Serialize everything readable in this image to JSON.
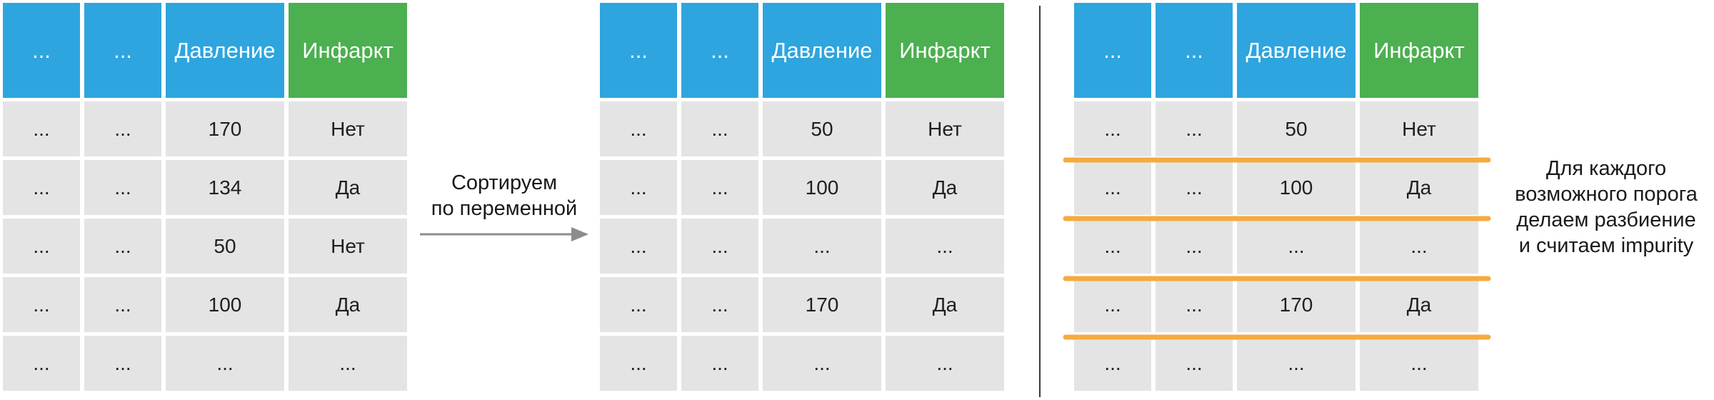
{
  "headers": [
    "...",
    "...",
    "Давление",
    "Инфаркт"
  ],
  "header_colors": [
    "#2ea5de",
    "#2ea5de",
    "#2ea5de",
    "#4caf50"
  ],
  "accent_line_color": "#f5ab3e",
  "tables": [
    {
      "rows": [
        [
          "...",
          "...",
          "170",
          "Нет"
        ],
        [
          "...",
          "...",
          "134",
          "Да"
        ],
        [
          "...",
          "...",
          "50",
          "Нет"
        ],
        [
          "...",
          "...",
          "100",
          "Да"
        ],
        [
          "...",
          "...",
          "...",
          "..."
        ]
      ]
    },
    {
      "rows": [
        [
          "...",
          "...",
          "50",
          "Нет"
        ],
        [
          "...",
          "...",
          "100",
          "Да"
        ],
        [
          "...",
          "...",
          "...",
          "..."
        ],
        [
          "...",
          "...",
          "170",
          "Да"
        ],
        [
          "...",
          "...",
          "...",
          "..."
        ]
      ]
    },
    {
      "rows": [
        [
          "...",
          "...",
          "50",
          "Нет"
        ],
        [
          "...",
          "...",
          "100",
          "Да"
        ],
        [
          "...",
          "...",
          "...",
          "..."
        ],
        [
          "...",
          "...",
          "170",
          "Да"
        ],
        [
          "...",
          "...",
          "...",
          "..."
        ]
      ]
    }
  ],
  "sort_caption": [
    "Сортируем",
    "по переменной"
  ],
  "threshold_caption": [
    "Для каждого",
    "возможного порога",
    "делаем разбиение",
    "и считаем impurity"
  ]
}
